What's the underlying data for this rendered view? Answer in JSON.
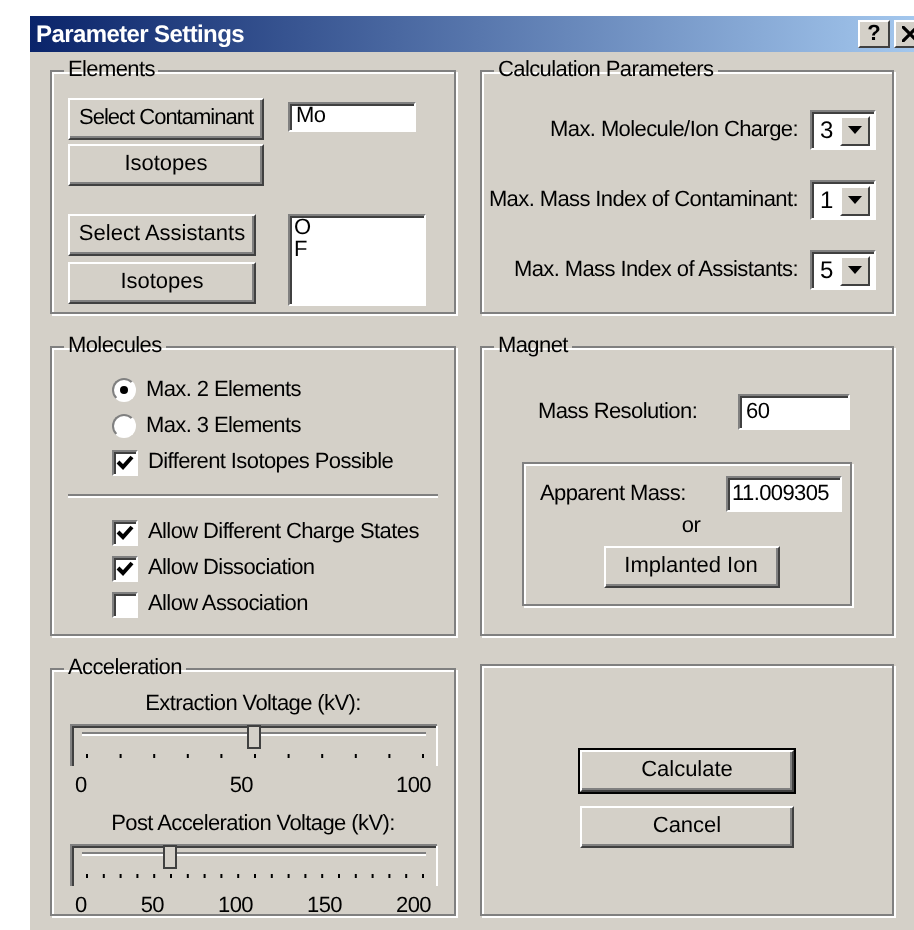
{
  "window": {
    "title": "Parameter Settings",
    "help_button": "?"
  },
  "elements": {
    "title": "Elements",
    "contaminant_button": "Select Contaminant",
    "contaminant_value": "Mo",
    "contaminant_isotopes_button": "Isotopes",
    "assistants_button": "Select Assistants",
    "assistants_list": [
      "O",
      "F"
    ],
    "assistants_isotopes_button": "Isotopes"
  },
  "calculation_parameters": {
    "title": "Calculation Parameters",
    "fields": [
      {
        "label": "Max. Molecule/Ion Charge:",
        "value": "3"
      },
      {
        "label": "Max. Mass Index of Contaminant:",
        "value": "1"
      },
      {
        "label": "Max. Mass Index of Assistants:",
        "value": "5"
      }
    ]
  },
  "molecules": {
    "title": "Molecules",
    "options": [
      {
        "kind": "radio",
        "label": "Max. 2 Elements",
        "selected": true
      },
      {
        "kind": "radio",
        "label": "Max. 3 Elements",
        "selected": false
      },
      {
        "kind": "checkbox",
        "label": "Different Isotopes Possible",
        "checked": true
      }
    ],
    "allow_options": [
      {
        "kind": "checkbox",
        "label": "Allow Different Charge States",
        "checked": true
      },
      {
        "kind": "checkbox",
        "label": "Allow Dissociation",
        "checked": true
      },
      {
        "kind": "checkbox",
        "label": "Allow Association",
        "checked": false
      }
    ]
  },
  "magnet": {
    "title": "Magnet",
    "mass_resolution_label": "Mass Resolution:",
    "mass_resolution": "60",
    "apparent_mass_label": "Apparent Mass:",
    "apparent_mass": "11.009305",
    "or_text": "or",
    "implanted_ion_button": "Implanted Ion"
  },
  "acceleration": {
    "title": "Acceleration",
    "sliders": [
      {
        "label": "Extraction Voltage (kV):",
        "level": 0.5,
        "scale": [
          "0",
          "50",
          "100"
        ]
      },
      {
        "label": "Post Acceleration Voltage (kV):",
        "level": 0.25,
        "scale": [
          "0",
          "50",
          "100",
          "150",
          "200"
        ]
      }
    ]
  },
  "actions": {
    "buttons": [
      {
        "label": "Calculate",
        "default": true
      },
      {
        "label": "Cancel",
        "default": false
      }
    ]
  }
}
